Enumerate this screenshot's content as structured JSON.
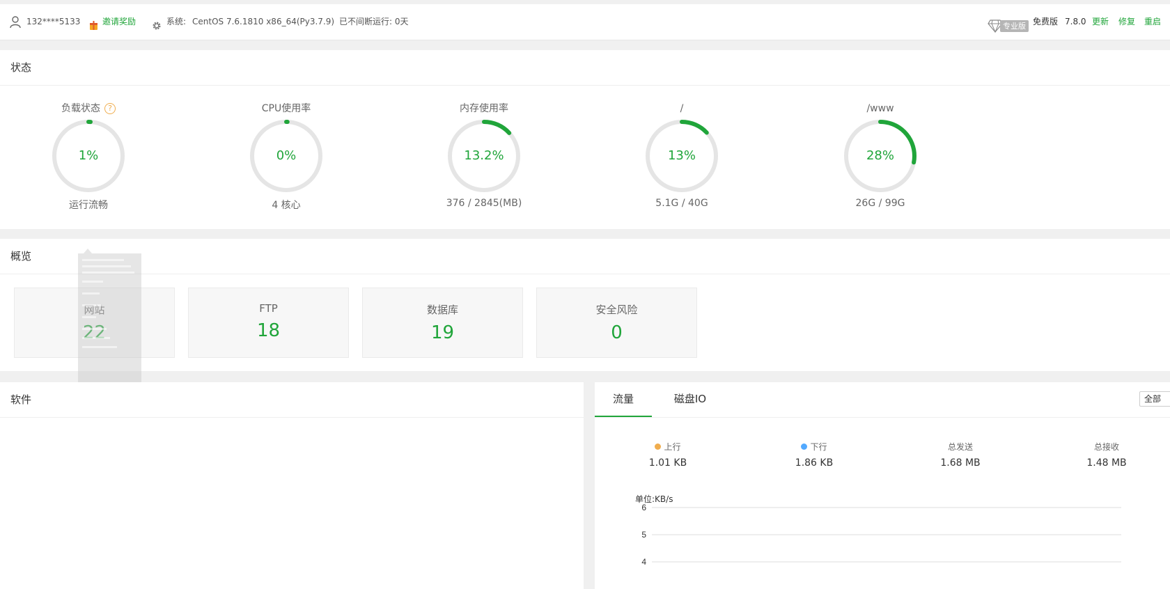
{
  "topbar": {
    "user": "132****5133",
    "invite": "邀请奖励",
    "system_label": "系统:",
    "system_value": "CentOS 7.6.1810 x86_64(Py3.7.9)",
    "uptime": "已不间断运行: 0天",
    "pro_badge": "专业版",
    "free_label": "免费版",
    "version": "7.8.0",
    "update": "更新",
    "repair": "修复",
    "restart": "重启"
  },
  "status": {
    "title": "状态",
    "gauges": [
      {
        "title": "负载状态",
        "value": "1%",
        "percent": 1,
        "sub": "运行流畅",
        "help": "?"
      },
      {
        "title": "CPU使用率",
        "value": "0%",
        "percent": 0,
        "sub": "4 核心"
      },
      {
        "title": "内存使用率",
        "value": "13.2%",
        "percent": 13.2,
        "sub": "376 / 2845(MB)"
      },
      {
        "title": "/",
        "value": "13%",
        "percent": 13,
        "sub": "5.1G / 40G"
      },
      {
        "title": "/www",
        "value": "28%",
        "percent": 28,
        "sub": "26G / 99G"
      }
    ]
  },
  "overview": {
    "title": "概览",
    "cards": [
      {
        "label": "网站",
        "count": "22"
      },
      {
        "label": "FTP",
        "count": "18"
      },
      {
        "label": "数据库",
        "count": "19"
      },
      {
        "label": "安全风险",
        "count": "0"
      }
    ]
  },
  "software": {
    "title": "软件"
  },
  "traffic": {
    "tabs": [
      "流量",
      "磁盘IO"
    ],
    "range": "全部",
    "stats": [
      {
        "label": "上行",
        "value": "1.01 KB",
        "dot": "#f0ad4e"
      },
      {
        "label": "下行",
        "value": "1.86 KB",
        "dot": "#52a9ff"
      },
      {
        "label": "总发送",
        "value": "1.68 MB"
      },
      {
        "label": "总接收",
        "value": "1.48 MB"
      }
    ],
    "unit": "单位:KB/s"
  },
  "chart_data": {
    "type": "line",
    "ylabel": "单位:KB/s",
    "y_ticks": [
      "6",
      "5",
      "4"
    ],
    "ylim": [
      4,
      6
    ],
    "grid": true,
    "series": []
  },
  "colors": {
    "accent": "#20a53a",
    "ring_track": "#e5e5e5",
    "upload": "#f0ad4e",
    "download": "#52a9ff"
  }
}
